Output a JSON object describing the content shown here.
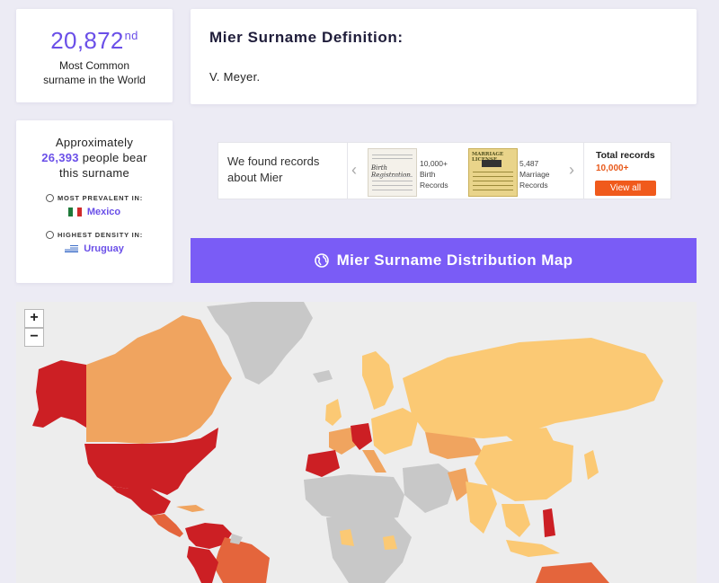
{
  "rank": {
    "value": "20,872",
    "suffix": "nd",
    "line1": "Most Common",
    "line2": "surname in the World"
  },
  "definition": {
    "title": "Mier Surname Definition:",
    "text": "V. Meyer."
  },
  "stats": {
    "line1": "Approximately",
    "count": "26,393",
    "count_tail": "people bear",
    "line3": "this surname",
    "prevalent_label": "MOST PREVALENT IN:",
    "prevalent_country": "Mexico",
    "density_label": "HIGHEST DENSITY IN:",
    "density_country": "Uruguay"
  },
  "records": {
    "found_line1": "We found records",
    "found_line2": "about Mier",
    "birth_thumb_title": "Birth Registration",
    "birth_count": "10,000+",
    "birth_label1": "Birth",
    "birth_label2": "Records",
    "marriage_thumb_title": "MARRIAGE LICENSE",
    "marriage_count": "5,487",
    "marriage_label1": "Marriage",
    "marriage_label2": "Records",
    "total_label": "Total records",
    "total_value": "10,000+",
    "view_all": "View all"
  },
  "map_button": {
    "label": "Mier Surname Distribution Map",
    "icon": "globe-icon"
  },
  "map": {
    "zoom_in": "+",
    "zoom_out": "−",
    "colors": {
      "highest": "#cc1f24",
      "high": "#e4653c",
      "medium": "#f0a45f",
      "low": "#fbc974",
      "none": "#c8c8c8",
      "ocean": "#ededed"
    }
  }
}
